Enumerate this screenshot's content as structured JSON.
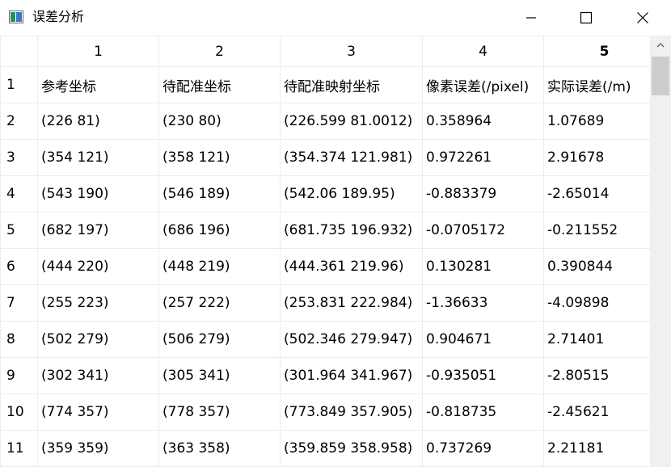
{
  "window": {
    "title": "误差分析"
  },
  "table": {
    "column_headers": [
      "1",
      "2",
      "3",
      "4",
      "5"
    ],
    "row_headers": [
      "1",
      "2",
      "3",
      "4",
      "5",
      "6",
      "7",
      "8",
      "9",
      "10",
      "11"
    ],
    "rows": [
      [
        "参考坐标",
        "待配准坐标",
        "待配准映射坐标",
        "像素误差(/pixel)",
        "实际误差(/m)"
      ],
      [
        "(226 81)",
        "(230 80)",
        "(226.599 81.0012)",
        "0.358964",
        "1.07689"
      ],
      [
        "(354 121)",
        "(358 121)",
        "(354.374 121.981)",
        "0.972261",
        "2.91678"
      ],
      [
        "(543 190)",
        "(546 189)",
        "(542.06 189.95)",
        "-0.883379",
        "-2.65014"
      ],
      [
        "(682 197)",
        "(686 196)",
        "(681.735 196.932)",
        "-0.0705172",
        "-0.211552"
      ],
      [
        "(444 220)",
        "(448 219)",
        "(444.361 219.96)",
        "0.130281",
        "0.390844"
      ],
      [
        "(255 223)",
        "(257 222)",
        "(253.831 222.984)",
        "-1.36633",
        "-4.09898"
      ],
      [
        "(502 279)",
        "(506 279)",
        "(502.346 279.947)",
        "0.904671",
        "2.71401"
      ],
      [
        "(302 341)",
        "(305 341)",
        "(301.964 341.967)",
        "-0.935051",
        "-2.80515"
      ],
      [
        "(774 357)",
        "(778 357)",
        "(773.849 357.905)",
        "-0.818735",
        "-2.45621"
      ],
      [
        "(359 359)",
        "(363 358)",
        "(359.859 358.958)",
        "0.737269",
        "2.21181"
      ]
    ]
  },
  "icons": {
    "app": "app-window-icon",
    "minimize": "minimize-icon",
    "maximize": "maximize-icon",
    "close": "close-icon",
    "scroll_up": "chevron-up-icon"
  }
}
